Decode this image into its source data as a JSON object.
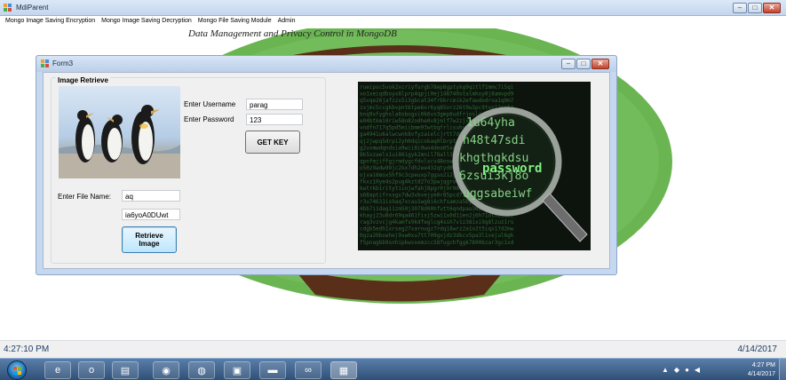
{
  "mdi": {
    "title": "MdiParent",
    "minimize_glyph": "–",
    "maximize_glyph": "□",
    "close_glyph": "✕"
  },
  "menu": [
    {
      "label": "Mongo Image Saving Encryption"
    },
    {
      "label": "Mongo Image Saving Decryption"
    },
    {
      "label": "Mongo File Saving Module"
    },
    {
      "label": "Admin"
    }
  ],
  "background": {
    "title": "Data Management and Privacy Control in MongoDB",
    "ellipse_color": "#6ab552",
    "frame_color": "#5a2f1a"
  },
  "form": {
    "title": "Form3",
    "group_title": "Image Retrieve",
    "picture_icon": "penguins-image",
    "username_label": "Enter Username",
    "username_value": "parag",
    "password_label": "Enter Password",
    "password_value": "123",
    "get_key_label": "GET KEY",
    "file_name_label": "Enter File Name:",
    "file_name_value": "aq",
    "key_value": "ia6yoA0DUwt",
    "retrieve_label": "Retrieve\nImage",
    "side_image_icon": "password-magnifier-image",
    "side_image_word": "password"
  },
  "status": {
    "time": "4:27:10 PM",
    "date": "4/14/2017"
  },
  "taskbar": {
    "apps": [
      {
        "icon": "internet-explorer-icon",
        "glyph": "e"
      },
      {
        "icon": "outlook-icon",
        "glyph": "o"
      },
      {
        "icon": "folder-icon",
        "glyph": "▤"
      },
      {
        "icon": "chrome-icon",
        "glyph": "◉"
      },
      {
        "icon": "firefox-icon",
        "glyph": "◍"
      },
      {
        "icon": "window-icon",
        "glyph": "▣"
      },
      {
        "icon": "cmd-icon",
        "glyph": "▬"
      },
      {
        "icon": "infinity-icon",
        "glyph": "∞"
      },
      {
        "icon": "app-icon",
        "glyph": "▦"
      }
    ],
    "clock_time": "4:27 PM",
    "clock_date": "4/14/2017"
  },
  "colors": {
    "accent": "#2e4f78",
    "matrix_green": "#6ee06e"
  }
}
